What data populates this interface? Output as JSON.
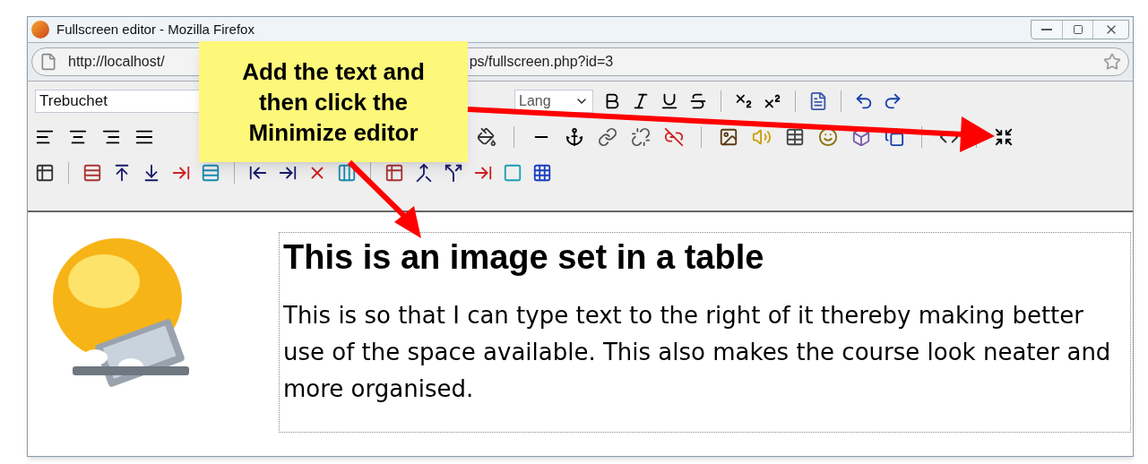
{
  "window": {
    "title": "Fullscreen editor - Mozilla Firefox"
  },
  "address_bar": {
    "url_parts": [
      "http://localhost/",
      "ps/fullscreen.php?id=3"
    ]
  },
  "toolbar": {
    "font": "Trebuchet",
    "language": "Lang"
  },
  "content": {
    "heading": "This is an image set in a table",
    "paragraph": "This is so that I can type text to the right of it thereby making better use of the space available. This also makes the course look neater and more organised."
  },
  "callout": {
    "lines": [
      "Add the text and",
      "then click the",
      "Minimize editor"
    ]
  }
}
